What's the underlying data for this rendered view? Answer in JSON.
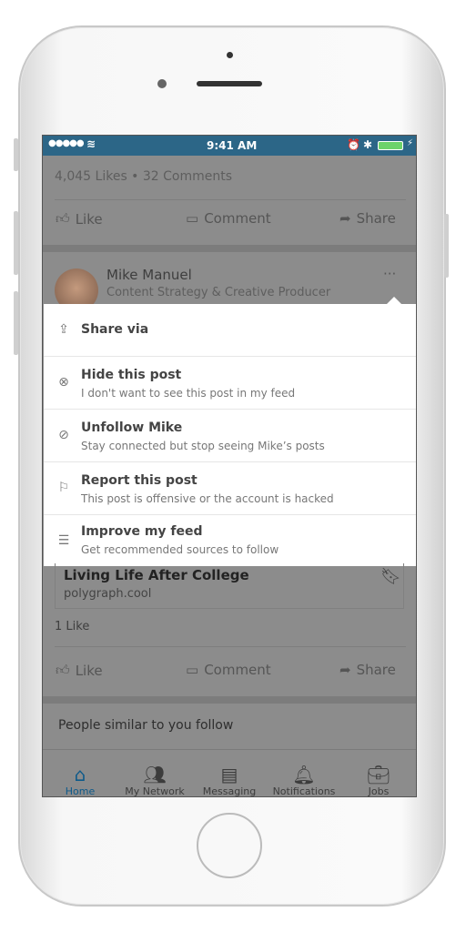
{
  "status_bar": {
    "time": "9:41 AM"
  },
  "post1": {
    "stats": "4,045 Likes • 32 Comments",
    "like": "Like",
    "comment": "Comment",
    "share": "Share"
  },
  "post2": {
    "author": "Mike Manuel",
    "headline": "Content Strategy & Creative Producer",
    "more": "···",
    "article_title": "Living Life After College",
    "article_source": "polygraph.cool",
    "likes": "1 Like",
    "like": "Like",
    "comment": "Comment",
    "share": "Share"
  },
  "suggestion": "People similar to you follow",
  "menu": {
    "items": [
      {
        "title": "Share via",
        "subtitle": "",
        "icon": "share-icon"
      },
      {
        "title": "Hide this post",
        "subtitle": "I don't want to see this post in my feed",
        "icon": "hide-icon"
      },
      {
        "title": "Unfollow Mike",
        "subtitle": "Stay connected but stop seeing Mike’s posts",
        "icon": "unfollow-icon"
      },
      {
        "title": "Report this post",
        "subtitle": "This post is offensive or the account is hacked",
        "icon": "flag-icon"
      },
      {
        "title": "Improve my feed",
        "subtitle": "Get recommended sources to follow",
        "icon": "sliders-icon"
      }
    ]
  },
  "tabs": [
    {
      "label": "Home",
      "active": true
    },
    {
      "label": "My Network"
    },
    {
      "label": "Messaging"
    },
    {
      "label": "Notifications"
    },
    {
      "label": "Jobs"
    }
  ],
  "colors": {
    "accent": "#0e5a8a",
    "status_bar": "#2c6687",
    "overlay": "#8c8c8c"
  }
}
